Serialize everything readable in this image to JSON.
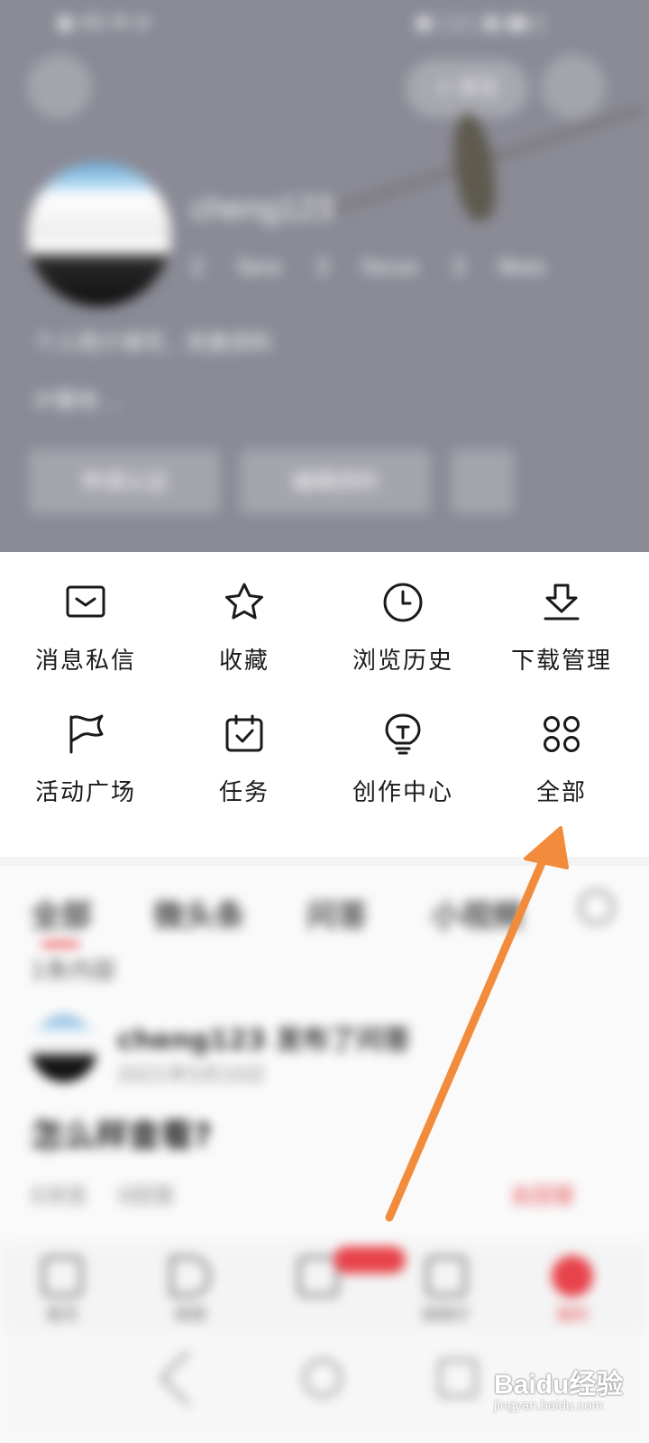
{
  "header": {
    "status_left": "▣ 4G ✉ ⊘",
    "status_right": "▣ ▢▢ ▦ ▮▮ ▯",
    "pill_label": "+ 关注",
    "user_name": "cheng123",
    "stats": "2 fans 3 focus 3 likes",
    "bio": "个人简介填写，完善资料",
    "bio2": "IP属地 ...",
    "btn_primary": "申请认证",
    "btn_secondary": "编辑资料"
  },
  "menu": {
    "items": [
      {
        "label": "消息私信",
        "icon": "mail-icon"
      },
      {
        "label": "收藏",
        "icon": "star-icon"
      },
      {
        "label": "浏览历史",
        "icon": "clock-icon"
      },
      {
        "label": "下载管理",
        "icon": "download-icon"
      },
      {
        "label": "活动广场",
        "icon": "flag-icon"
      },
      {
        "label": "任务",
        "icon": "calendar-check-icon"
      },
      {
        "label": "创作中心",
        "icon": "lightbulb-icon"
      },
      {
        "label": "全部",
        "icon": "grid-icon"
      }
    ]
  },
  "feed": {
    "tabs": [
      "全部",
      "微头条",
      "问答",
      "小视频"
    ],
    "count": "1条内容",
    "post_title": "cheng123 发布了问答",
    "post_time": "2021年5月10日",
    "post_body": "怎么样查看?",
    "post_meta": "0浏览 0回答",
    "post_link": "去回答"
  },
  "tabbar": {
    "items": [
      "首页",
      "视频",
      "放映厅",
      "我的"
    ]
  },
  "watermark": {
    "brand": "Baidu经验",
    "url": "jingyan.baidu.com"
  },
  "colors": {
    "accent": "#e8434a",
    "arrow": "#f28c3c",
    "header_bg": "#8b8b96"
  }
}
